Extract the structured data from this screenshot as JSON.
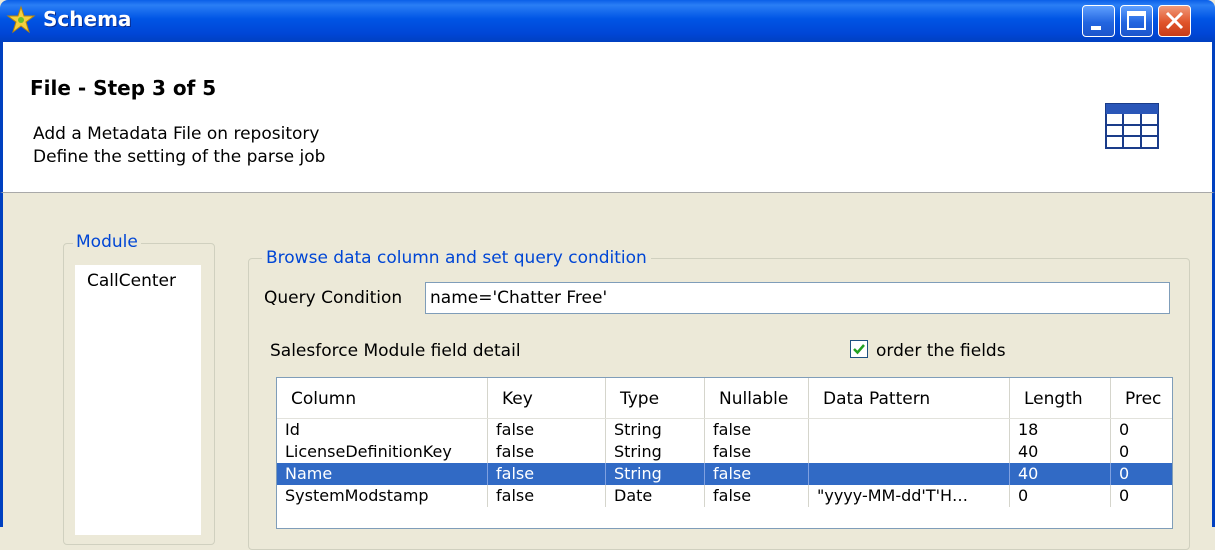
{
  "window": {
    "title": "Schema"
  },
  "header": {
    "step_title": "File - Step 3 of 5",
    "description_line1": "Add a Metadata File on repository",
    "description_line2": "Define the setting of the parse job",
    "icon": "table-icon"
  },
  "module": {
    "group_label": "Module",
    "items": [
      "CallCenter"
    ]
  },
  "browse": {
    "group_label": "Browse data column and set query condition",
    "query_label": "Query Condition",
    "query_value": "name='Chatter Free'",
    "field_detail_label": "Salesforce Module field detail",
    "order_fields_label": "order the fields",
    "order_fields_checked": true
  },
  "table": {
    "columns": [
      "Column",
      "Key",
      "Type",
      "Nullable",
      "Data Pattern",
      "Length",
      "Prec"
    ],
    "rows": [
      [
        "Id",
        "false",
        "String",
        "false",
        "",
        "18",
        "0"
      ],
      [
        "LicenseDefinitionKey",
        "false",
        "String",
        "false",
        "",
        "40",
        "0"
      ],
      [
        "Name",
        "false",
        "String",
        "false",
        "",
        "40",
        "0"
      ],
      [
        "SystemModstamp",
        "false",
        "Date",
        "false",
        "\"yyyy-MM-dd'T'H…",
        "0",
        "0"
      ]
    ],
    "selected_row": 2
  },
  "colors": {
    "titlebar": "#0055e5",
    "selection": "#316ac5",
    "group_label": "#0046d5"
  }
}
